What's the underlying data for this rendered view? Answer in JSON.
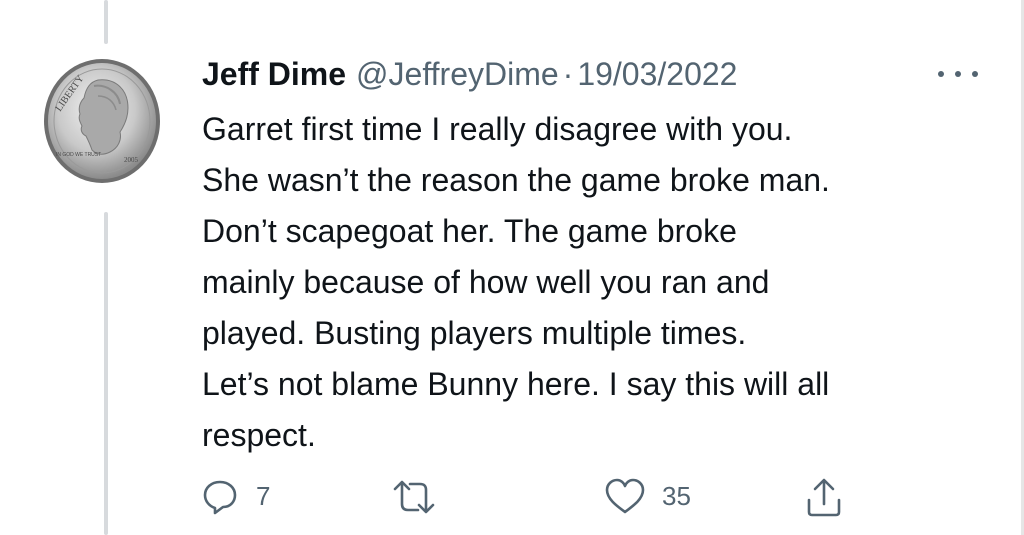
{
  "tweet": {
    "display_name": "Jeff Dime",
    "handle": "@JeffreyDime",
    "separator": "·",
    "date": "19/03/2022",
    "text_lines": [
      "Garret first time I really disagree with you.",
      "She wasn’t the reason the game broke man.",
      "Don’t scapegoat her.  The game broke",
      "mainly because of how well you ran and",
      "played.  Busting players multiple times.",
      "Let’s not blame Bunny here. I say this will all",
      "respect."
    ],
    "avatar": {
      "icon": "dime-coin-avatar",
      "coin_text": [
        "LIBERTY",
        "IN GOD WE TRUST",
        "2005"
      ]
    }
  },
  "actions": {
    "reply": {
      "icon": "reply-icon",
      "count": "7"
    },
    "retweet": {
      "icon": "retweet-icon",
      "count": ""
    },
    "like": {
      "icon": "heart-icon",
      "count": "35"
    },
    "share": {
      "icon": "share-icon"
    }
  },
  "menu": {
    "icon": "more-options-icon"
  },
  "colors": {
    "text": "#0f1419",
    "secondary": "#536471",
    "thread_line": "#d7dadd"
  }
}
